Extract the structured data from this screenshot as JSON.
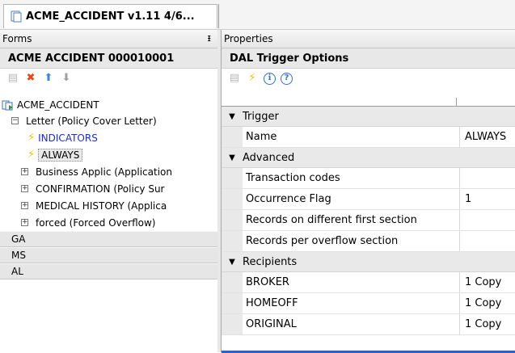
{
  "tab": {
    "title": "ACME_ACCIDENT v1.11 4/6..."
  },
  "forms_panel": {
    "header": "Forms",
    "pin_glyph": "ᵻ",
    "section_title": "ACME ACCIDENT 000010001",
    "toolbar": [
      {
        "icon": "properties-icon",
        "glyph": "▤",
        "color": "#b8b8b8"
      },
      {
        "icon": "delete-icon",
        "glyph": "✖",
        "color": "#e24b16"
      },
      {
        "icon": "move-up-icon",
        "glyph": "⬆",
        "color": "#3a86d8"
      },
      {
        "icon": "move-down-icon",
        "glyph": "⬇",
        "color": "#a0a0a0"
      }
    ],
    "tree": {
      "root": "ACME_ACCIDENT",
      "letter": "Letter (Policy Cover Letter)",
      "triggers": [
        "INDICATORS",
        "ALWAYS"
      ],
      "forms": [
        "Business Applic (Application",
        "CONFIRMATION (Policy Sur",
        "MEDICAL HISTORY (Applica",
        "forced (Forced Overflow)"
      ],
      "groups": [
        "GA",
        "MS",
        "AL"
      ]
    }
  },
  "properties_panel": {
    "header": "Properties",
    "section_title": "DAL Trigger Options",
    "toolbar": [
      {
        "icon": "properties-icon",
        "glyph": "▤",
        "color": "#b8b8b8"
      },
      {
        "icon": "trigger-bolt-icon",
        "glyph": "⚡",
        "color": "#f2c200"
      },
      {
        "icon": "info-icon",
        "glyph": "ℹ",
        "color": "#2f6fd0"
      },
      {
        "icon": "help-icon",
        "glyph": "?",
        "color": "#2f6fd0"
      }
    ],
    "categories": [
      {
        "name": "Trigger",
        "rows": [
          {
            "name": "Name",
            "value": "ALWAYS"
          }
        ]
      },
      {
        "name": "Advanced",
        "rows": [
          {
            "name": "Transaction codes",
            "value": ""
          },
          {
            "name": "Occurrence Flag",
            "value": "1"
          },
          {
            "name": "Records on different first section",
            "value": ""
          },
          {
            "name": "Records per overflow section",
            "value": ""
          }
        ]
      },
      {
        "name": "Recipients",
        "rows": [
          {
            "name": "BROKER",
            "value": "1 Copy"
          },
          {
            "name": "HOMEOFF",
            "value": "1 Copy"
          },
          {
            "name": "ORIGINAL",
            "value": "1 Copy"
          }
        ]
      }
    ]
  },
  "colors": {
    "link": "#1a2dd8",
    "bolt": "#f2c200",
    "selection_bar": "#2d62c7"
  }
}
